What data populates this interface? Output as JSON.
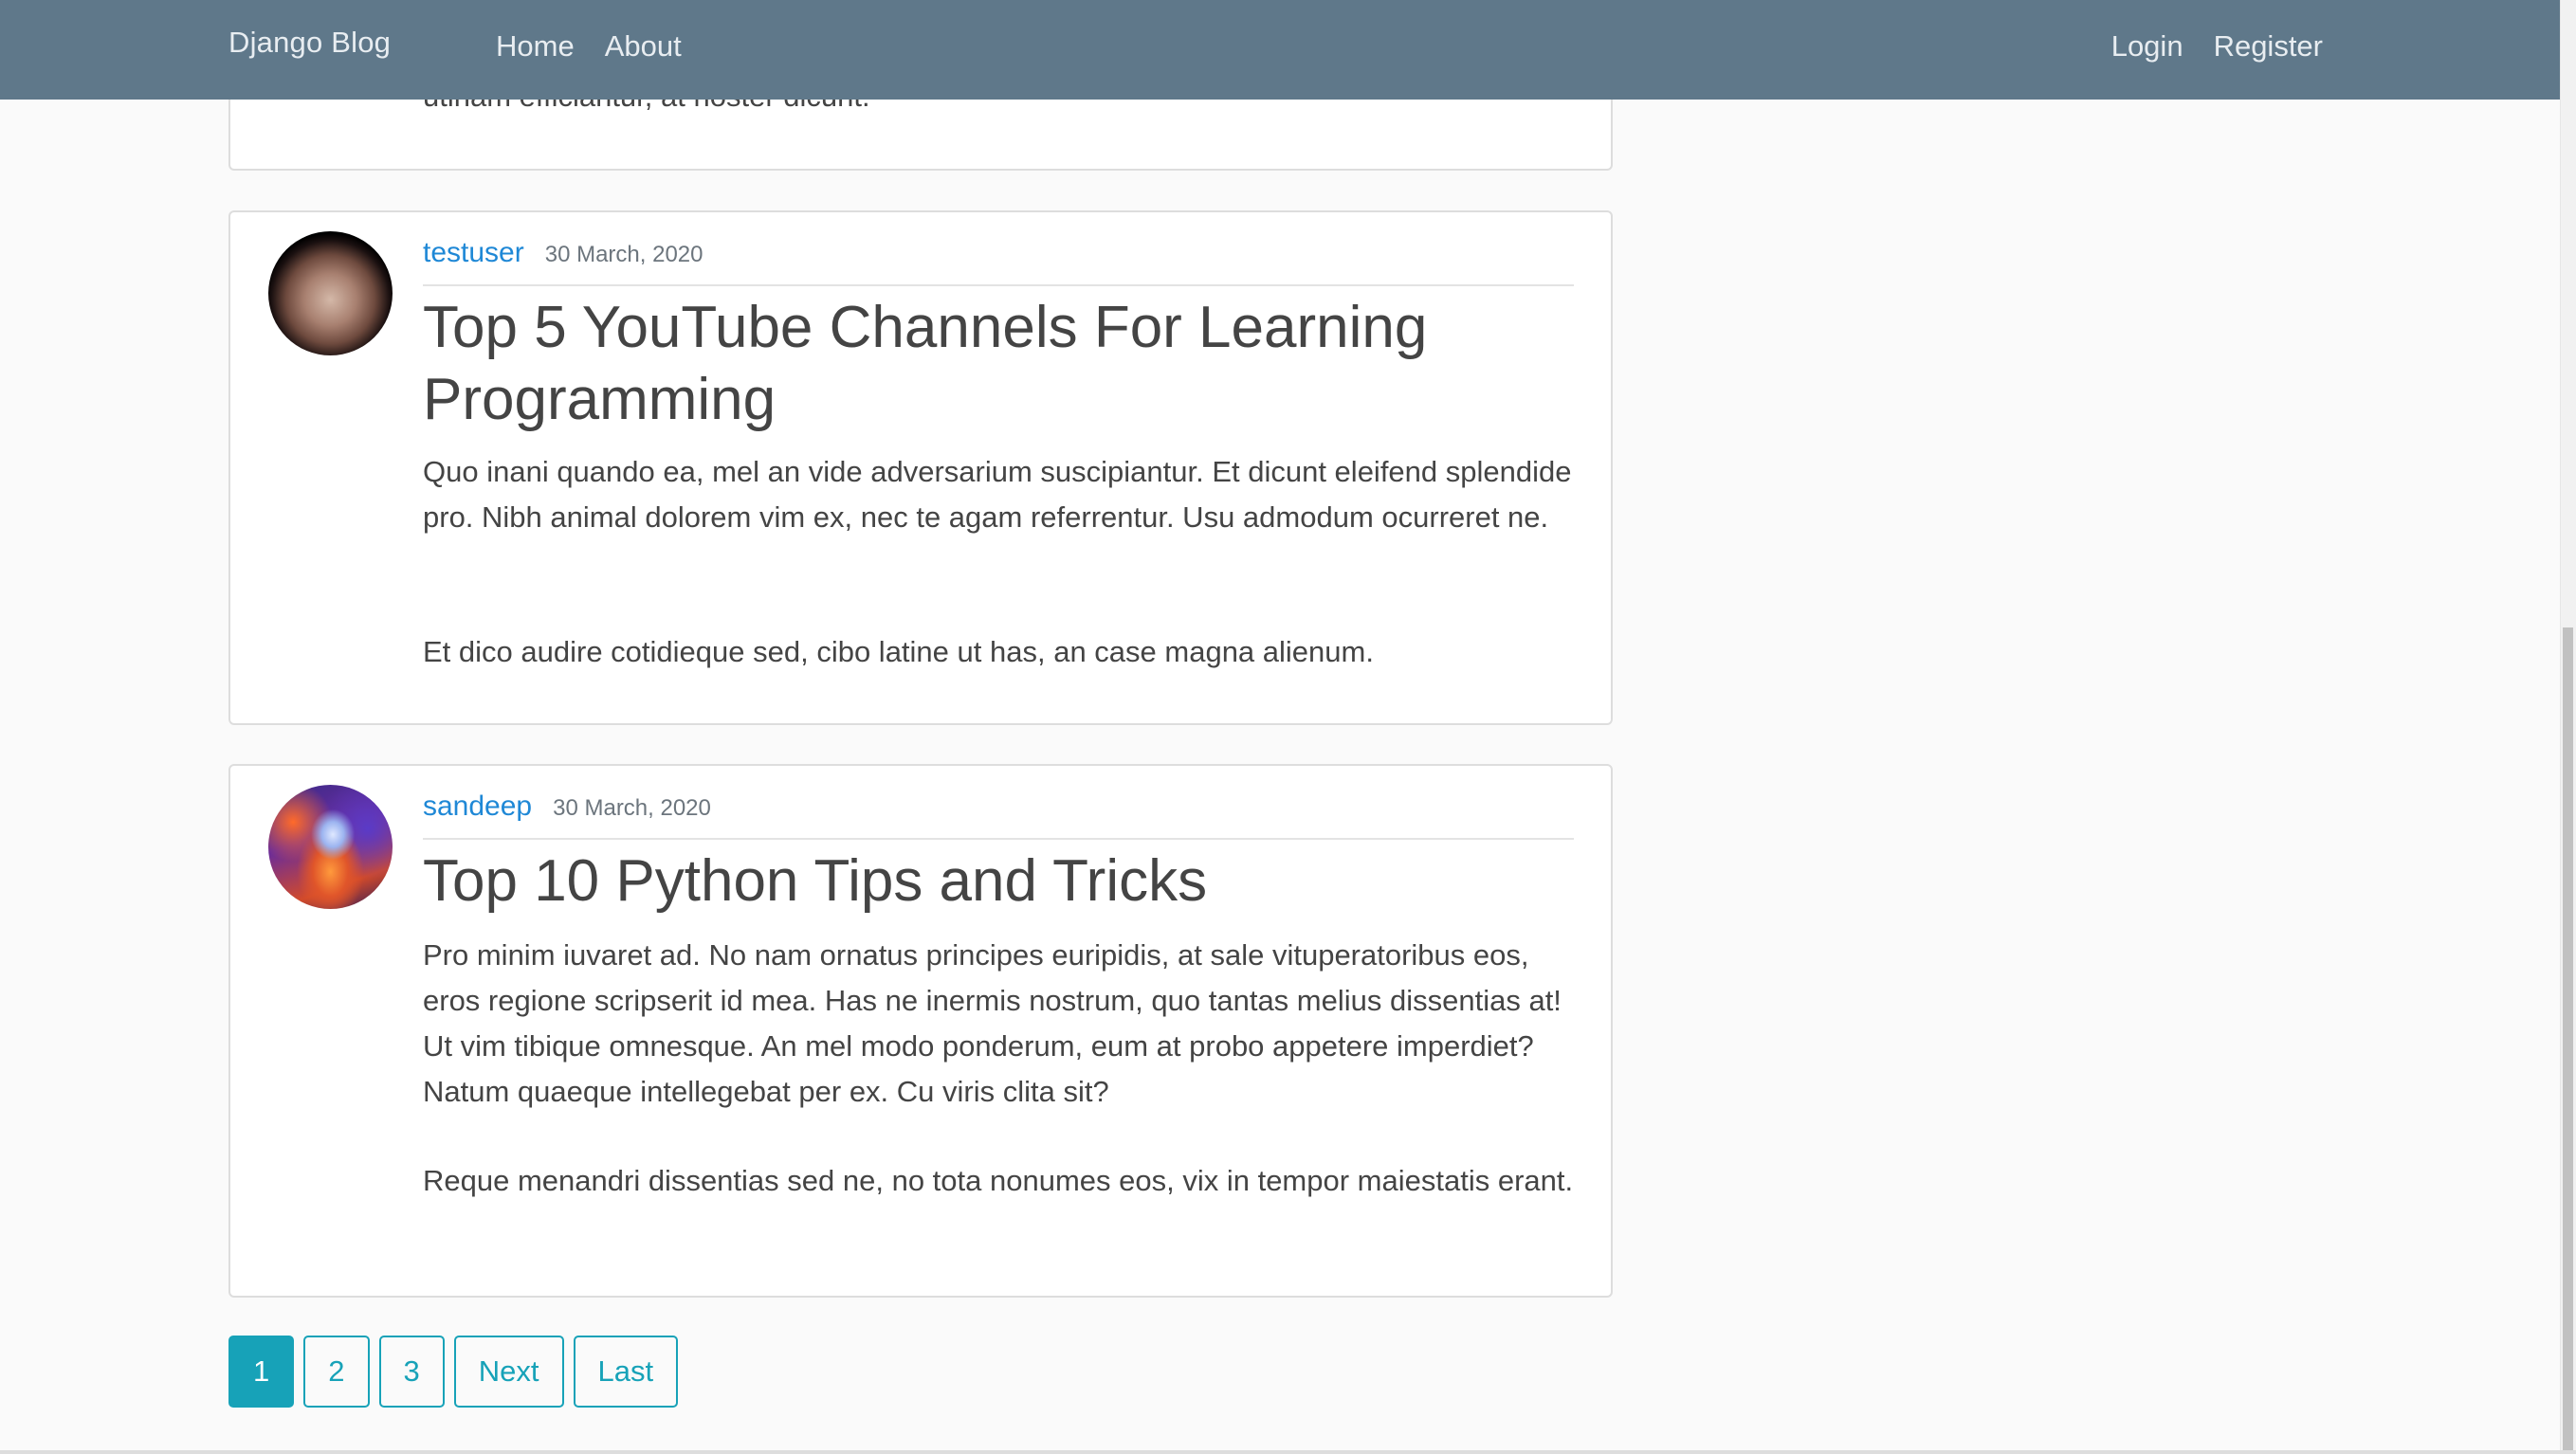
{
  "navbar": {
    "brand": "Django Blog",
    "left_links": [
      "Home",
      "About"
    ],
    "right_links": [
      "Login",
      "Register"
    ],
    "background": "#5f788a"
  },
  "posts": [
    {
      "partial_text": "utinam efficiantur, at noster dicunt."
    },
    {
      "author": "testuser",
      "date": "30 March, 2020",
      "avatar_icon": "pluto-avatar",
      "title": "Top 5 YouTube Channels For Learning Programming",
      "paragraphs": [
        "Quo inani quando ea, mel an vide adversarium suscipiantur. Et dicunt eleifend splendide pro. Nibh animal dolorem vim ex, nec te agam referrentur. Usu admodum ocurreret ne.",
        "Et dico audire cotidieque sed, cibo latine ut has, an case magna alienum."
      ]
    },
    {
      "author": "sandeep",
      "date": "30 March, 2020",
      "avatar_icon": "anime-character-avatar",
      "title": "Top 10 Python Tips and Tricks",
      "paragraphs": [
        "Pro minim iuvaret ad. No nam ornatus principes euripidis, at sale vituperatoribus eos, eros regione scripserit id mea. Has ne inermis nostrum, quo tantas melius dissentias at! Ut vim tibique omnesque. An mel modo ponderum, eum at probo appetere imperdiet? Natum quaeque intellegebat per ex. Cu viris clita sit?",
        "Reque menandri dissentias sed ne, no tota nonumes eos, vix in tempor maiestatis erant."
      ]
    }
  ],
  "pagination": {
    "pages": [
      "1",
      "2",
      "3"
    ],
    "current": "1",
    "next": "Next",
    "last": "Last",
    "accent": "#17a2b8"
  }
}
